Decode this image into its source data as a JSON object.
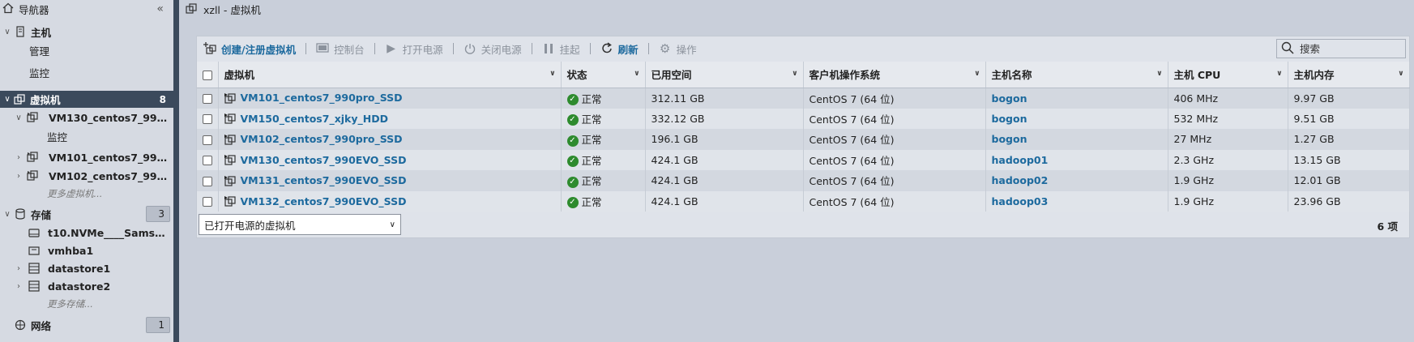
{
  "sidebar": {
    "title": "导航器",
    "host": {
      "label": "主机",
      "children": [
        "管理",
        "监控"
      ]
    },
    "vms": {
      "label": "虚拟机",
      "count": "8",
      "items": [
        {
          "label": "VM130_centos7_990...",
          "child": "监控"
        },
        {
          "label": "VM101_centos7_990p..."
        },
        {
          "label": "VM102_centos7_990..."
        }
      ],
      "more": "更多虚拟机..."
    },
    "storage": {
      "label": "存储",
      "count": "3",
      "items": [
        "t10.NVMe____Samsu...",
        "vmhba1",
        "datastore1",
        "datastore2"
      ],
      "more": "更多存储..."
    },
    "network": {
      "label": "网络",
      "count": "1"
    }
  },
  "window": {
    "title": "xzll - 虚拟机"
  },
  "toolbar": {
    "create": "创建/注册虚拟机",
    "console": "控制台",
    "power_on": "打开电源",
    "power_off": "关闭电源",
    "suspend": "挂起",
    "refresh": "刷新",
    "actions": "操作",
    "search_placeholder": "搜索"
  },
  "table": {
    "columns": [
      "虚拟机",
      "状态",
      "已用空间",
      "客户机操作系统",
      "主机名称",
      "主机 CPU",
      "主机内存"
    ],
    "rows": [
      {
        "name": "VM101_centos7_990pro_SSD",
        "status": "正常",
        "space": "312.11 GB",
        "os": "CentOS 7 (64 位)",
        "host": "bogon",
        "cpu": "406 MHz",
        "mem": "9.97 GB"
      },
      {
        "name": "VM150_centos7_xjky_HDD",
        "status": "正常",
        "space": "332.12 GB",
        "os": "CentOS 7 (64 位)",
        "host": "bogon",
        "cpu": "532 MHz",
        "mem": "9.51 GB"
      },
      {
        "name": "VM102_centos7_990pro_SSD",
        "status": "正常",
        "space": "196.1 GB",
        "os": "CentOS 7 (64 位)",
        "host": "bogon",
        "cpu": "27 MHz",
        "mem": "1.27 GB"
      },
      {
        "name": "VM130_centos7_990EVO_SSD",
        "status": "正常",
        "space": "424.1 GB",
        "os": "CentOS 7 (64 位)",
        "host": "hadoop01",
        "cpu": "2.3 GHz",
        "mem": "13.15 GB"
      },
      {
        "name": "VM131_centos7_990EVO_SSD",
        "status": "正常",
        "space": "424.1 GB",
        "os": "CentOS 7 (64 位)",
        "host": "hadoop02",
        "cpu": "1.9 GHz",
        "mem": "12.01 GB"
      },
      {
        "name": "VM132_centos7_990EVO_SSD",
        "status": "正常",
        "space": "424.1 GB",
        "os": "CentOS 7 (64 位)",
        "host": "hadoop03",
        "cpu": "1.9 GHz",
        "mem": "23.96 GB"
      }
    ]
  },
  "footer": {
    "filter": "已打开电源的虚拟机",
    "count": "6 项"
  },
  "colors": {
    "accent": "#1d6a9e",
    "selected": "#3b4a5c",
    "ok": "#2e8b2e"
  }
}
